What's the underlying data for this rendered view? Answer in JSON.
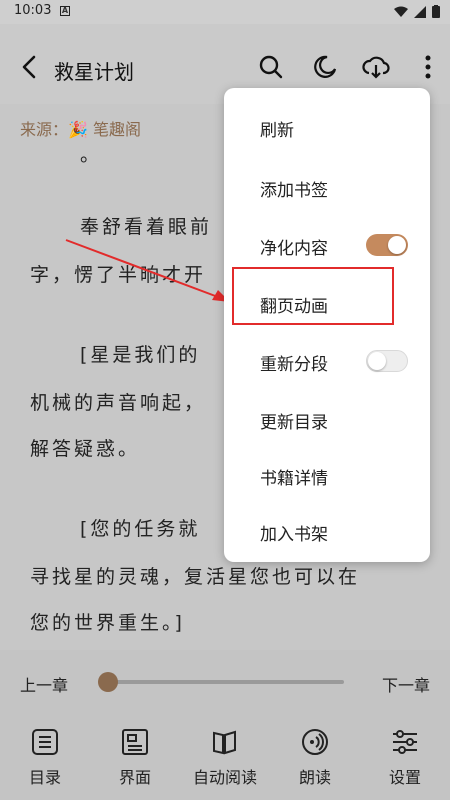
{
  "status": {
    "time": "10:03"
  },
  "header": {
    "title": "救星计划"
  },
  "reader": {
    "source_label": "来源：🎉 笔趣阁",
    "lines": [
      "。",
      "奉舒看着眼前",
      "字，愣了半晌才开",
      "[星是我们的",
      "机械的声音响起，",
      "解答疑惑。",
      "[您的任务就",
      "寻找星的灵魂，复活星您也可以在",
      "您的世界重生。]"
    ]
  },
  "chapter_bar": {
    "prev": "上一章",
    "next": "下一章",
    "progress": 0.0
  },
  "bottom_nav": [
    {
      "label": "目录",
      "icon": "list-icon"
    },
    {
      "label": "界面",
      "icon": "layout-icon"
    },
    {
      "label": "自动阅读",
      "icon": "book-icon"
    },
    {
      "label": "朗读",
      "icon": "speaker-icon"
    },
    {
      "label": "设置",
      "icon": "sliders-icon"
    }
  ],
  "menu": {
    "items": [
      {
        "label": "刷新"
      },
      {
        "label": "添加书签"
      },
      {
        "label": "净化内容",
        "toggle": true,
        "on": true
      },
      {
        "label": "翻页动画"
      },
      {
        "label": "重新分段",
        "toggle": true,
        "on": false
      },
      {
        "label": "更新目录"
      },
      {
        "label": "书籍详情"
      },
      {
        "label": "加入书架"
      }
    ]
  },
  "colors": {
    "accent": "#c58a5e",
    "highlight": "#e22b2b"
  }
}
